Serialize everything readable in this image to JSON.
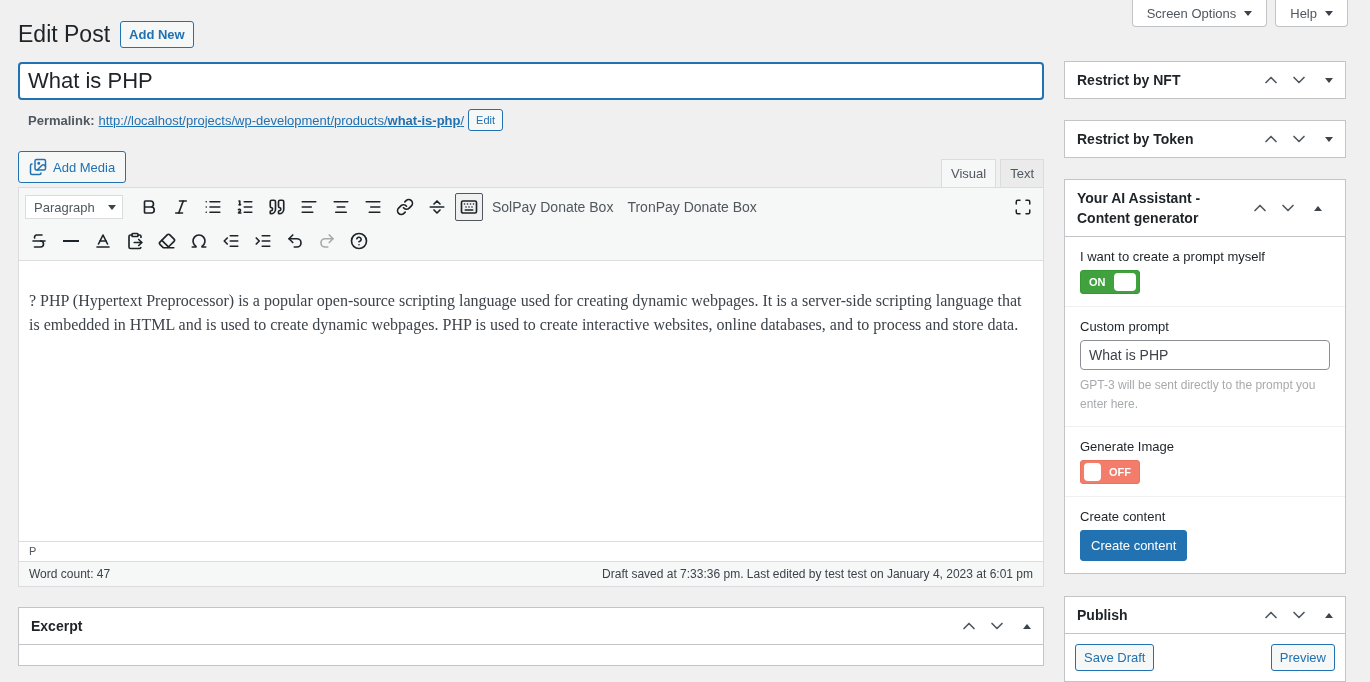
{
  "header": {
    "title": "Edit Post",
    "add_new": "Add New"
  },
  "screen_meta": [
    {
      "label": "Screen Options",
      "expanded": false
    },
    {
      "label": "Help",
      "expanded": false
    }
  ],
  "post_title": {
    "value": "What is PHP"
  },
  "permalink": {
    "label": "Permalink:",
    "url_base": "http://localhost/projects/wp-development/products/",
    "slug": "what-is-php",
    "trailing": "/",
    "edit": "Edit"
  },
  "add_media": "Add Media",
  "editor_tabs": [
    {
      "label": "Visual",
      "selected": true
    },
    {
      "label": "Text",
      "selected": false
    }
  ],
  "toolbar": {
    "format_select": "Paragraph",
    "row_1": [
      {
        "kind": "bold",
        "pressed": false
      },
      {
        "kind": "italic",
        "pressed": false
      },
      {
        "kind": "bullets",
        "pressed": false
      },
      {
        "kind": "numbers",
        "pressed": false
      },
      {
        "kind": "quote",
        "pressed": false
      },
      {
        "kind": "align-left",
        "pressed": false
      },
      {
        "kind": "align-center",
        "pressed": false
      },
      {
        "kind": "align-right",
        "pressed": false
      },
      {
        "kind": "link",
        "pressed": false
      },
      {
        "kind": "more",
        "pressed": false
      },
      {
        "kind": "kitchen-sink",
        "pressed": true
      }
    ],
    "text_buttons": [
      "SolPay Donate Box",
      "TronPay Donate Box"
    ],
    "row_2": [
      {
        "kind": "strikethrough",
        "disabled": false
      },
      {
        "kind": "hr",
        "disabled": false
      },
      {
        "kind": "text-color",
        "disabled": false
      },
      {
        "kind": "paste",
        "disabled": false
      },
      {
        "kind": "clear",
        "disabled": false
      },
      {
        "kind": "omega",
        "disabled": false
      },
      {
        "kind": "outdent",
        "disabled": false
      },
      {
        "kind": "indent",
        "disabled": false
      },
      {
        "kind": "undo",
        "disabled": false
      },
      {
        "kind": "redo",
        "disabled": true
      },
      {
        "kind": "help",
        "disabled": false
      }
    ]
  },
  "content": "? PHP (Hypertext Preprocessor) is a popular open-source scripting language used for creating dynamic webpages. It is a server-side scripting language that is embedded in HTML and is used to create dynamic webpages. PHP is used to create interactive websites, online databases, and to process and store data.",
  "path": "P",
  "status": {
    "word_count": "Word count: 47",
    "draft": "Draft saved at 7:33:36 pm. Last edited by test test on January 4, 2023 at 6:01 pm"
  },
  "excerpt": {
    "title": "Excerpt",
    "expanded": true
  },
  "sidebar": [
    {
      "title": "Restrict by NFT",
      "expanded": false
    },
    {
      "title": "Restrict by Token",
      "expanded": false
    },
    {
      "title": "Your AI Assistant - Content generator",
      "expanded": true
    }
  ],
  "ai": {
    "prompt_toggle": {
      "label": "I want to create a prompt myself",
      "on": true,
      "text": "ON"
    },
    "custom_prompt": {
      "label": "Custom prompt",
      "value": "What is PHP",
      "help": "GPT-3 will be sent directly to the prompt you enter here."
    },
    "image_toggle": {
      "label": "Generate Image",
      "on": false,
      "text": "OFF"
    },
    "create": {
      "label": "Create content",
      "button": "Create content"
    }
  },
  "publish": {
    "title": "Publish",
    "expanded": true,
    "save_draft": "Save Draft",
    "preview": "Preview"
  }
}
